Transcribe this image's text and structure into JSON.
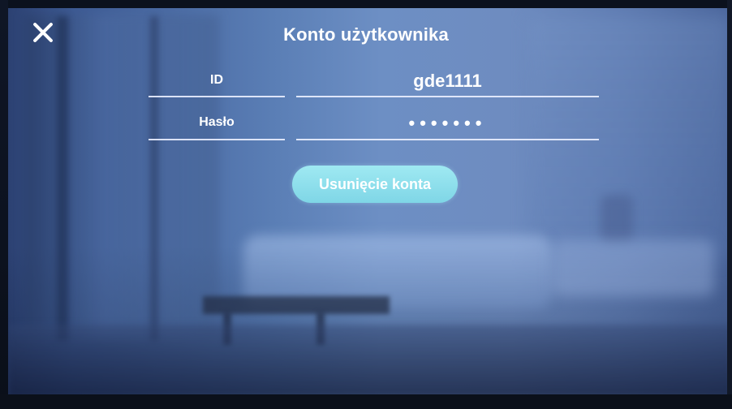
{
  "header": {
    "title": "Konto użytkownika",
    "close_icon": "close-icon"
  },
  "form": {
    "id_label": "ID",
    "id_value": "gde1111",
    "password_label": "Hasło",
    "password_value": "•••••••"
  },
  "actions": {
    "delete_account_label": "Usunięcie konta"
  },
  "colors": {
    "accent_button": "#8fe0ee",
    "text": "#ffffff",
    "underline": "#ebf0ff"
  }
}
